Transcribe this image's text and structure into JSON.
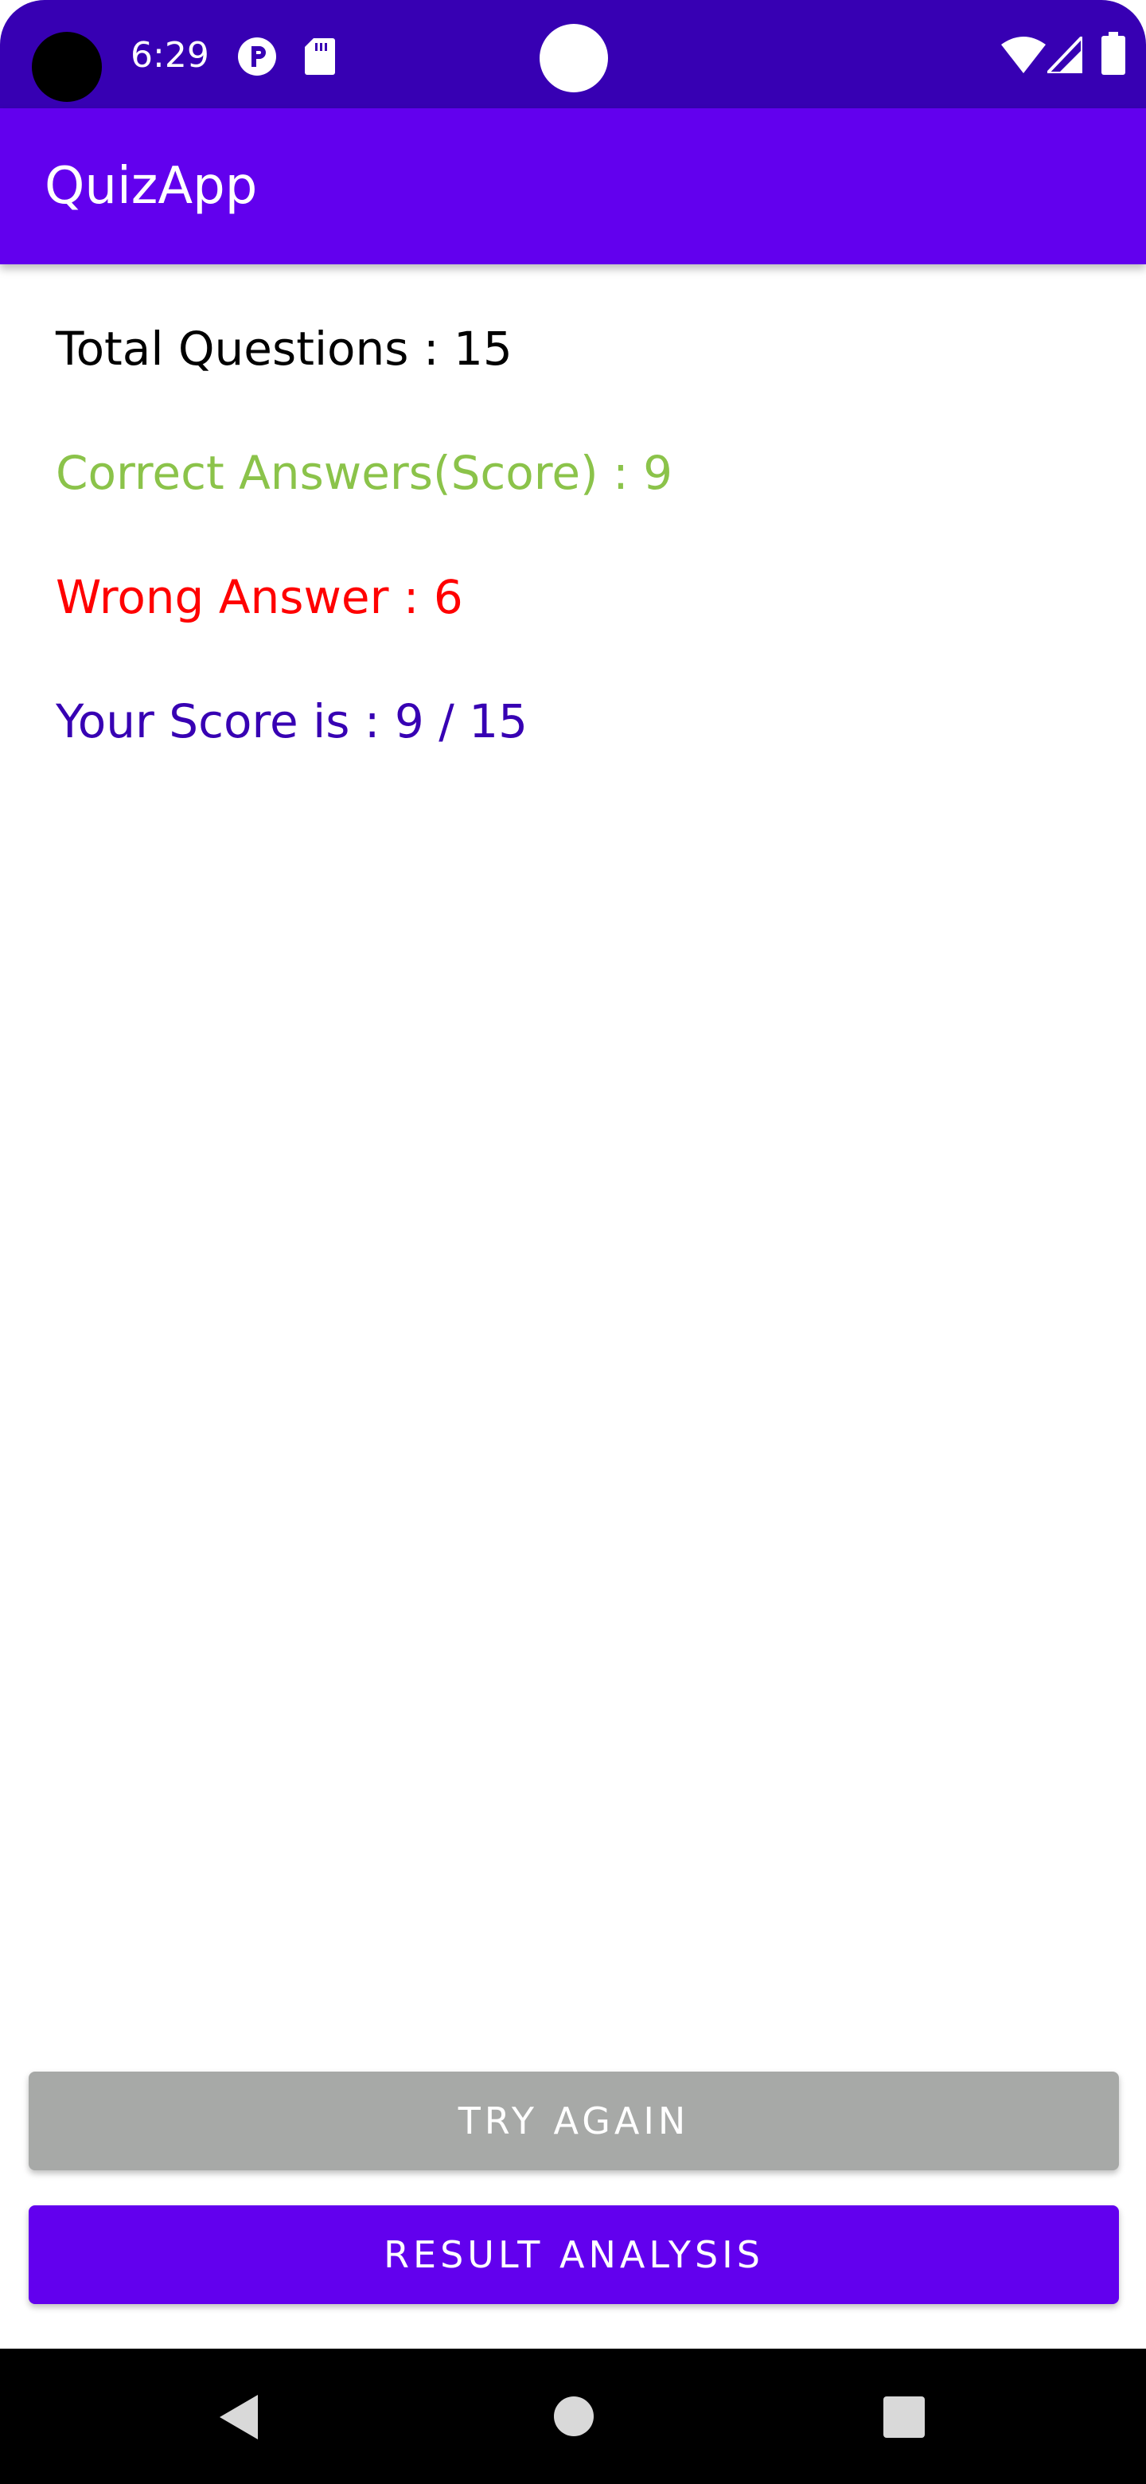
{
  "status_bar": {
    "time": "6:29",
    "icons": [
      "camera-cutout",
      "p-icon",
      "sd-card-icon",
      "notification-dot",
      "wifi-icon",
      "signal-icon",
      "battery-icon"
    ],
    "background": "#3700b3"
  },
  "app_bar": {
    "title": "QuizApp",
    "background": "#6200ee"
  },
  "results": {
    "total_questions": "Total Questions : 15",
    "correct_answers": "Correct Answers(Score) : 9",
    "wrong_answers": "Wrong Answer : 6",
    "your_score": "Your Score is : 9 / 15"
  },
  "colors": {
    "total": "#000000",
    "correct": "#8bc34a",
    "wrong": "#ff0000",
    "score": "#3700b3",
    "try_again_button": "#a7a9a7",
    "analysis_button": "#6200ee"
  },
  "buttons": {
    "try_again": "TRY AGAIN",
    "result_analysis": "RESULT ANALYSIS"
  },
  "nav_bar": {
    "icons": [
      "back-icon",
      "home-icon",
      "recents-icon"
    ]
  }
}
